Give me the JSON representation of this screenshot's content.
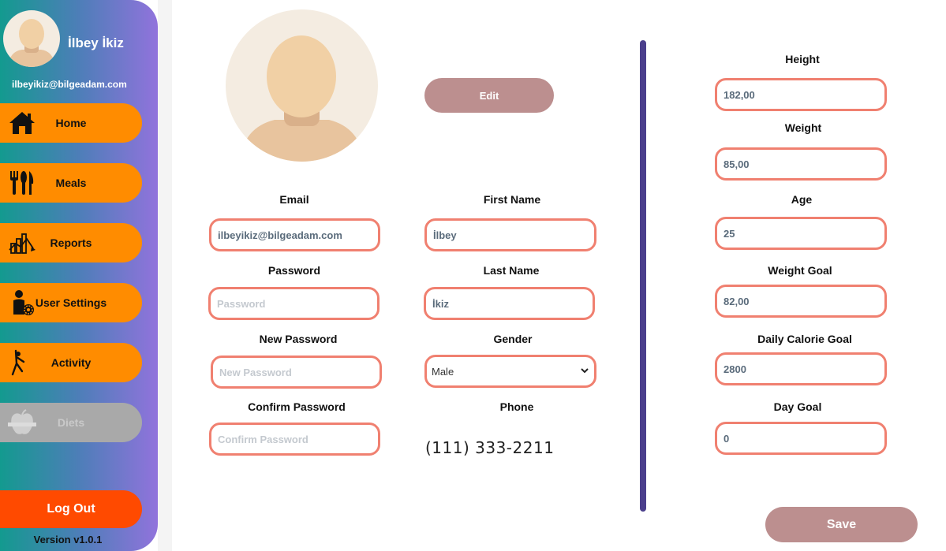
{
  "sidebar": {
    "user_name": "İlbey İkiz",
    "user_email": "ilbeyikiz@bilgeadam.com",
    "items": [
      {
        "label": "Home",
        "icon": "home-icon"
      },
      {
        "label": "Meals",
        "icon": "cutlery-icon"
      },
      {
        "label": "Reports",
        "icon": "reports-chart-icon"
      },
      {
        "label": "User Settings",
        "icon": "user-settings-icon"
      },
      {
        "label": "Activity",
        "icon": "running-person-icon"
      },
      {
        "label": "Diets",
        "icon": "apple-tape-icon",
        "disabled": true
      }
    ],
    "logout_label": "Log Out",
    "version": "Version v1.0.1",
    "accent_color": "#ff8c00",
    "logout_color": "#ff4a00"
  },
  "profile": {
    "edit_label": "Edit",
    "email": {
      "label": "Email",
      "value": "ilbeyikiz@bilgeadam.com"
    },
    "password": {
      "label": "Password",
      "placeholder": "Password"
    },
    "new_password": {
      "label": "New Password",
      "placeholder": "New Password"
    },
    "confirm_password": {
      "label": "Confirm Password",
      "placeholder": "Confirm Password"
    },
    "first_name": {
      "label": "First Name",
      "value": "İlbey"
    },
    "last_name": {
      "label": "Last Name",
      "value": "İkiz"
    },
    "gender": {
      "label": "Gender",
      "value": "Male"
    },
    "phone": {
      "label": "Phone",
      "value": "(111) 333-2211"
    }
  },
  "body_stats": {
    "height": {
      "label": "Height",
      "value": "182,00"
    },
    "weight": {
      "label": "Weight",
      "value": "85,00"
    },
    "age": {
      "label": "Age",
      "value": "25"
    },
    "weight_goal": {
      "label": "Weight Goal",
      "value": "82,00"
    },
    "daily_calorie_goal": {
      "label": "Daily Calorie Goal",
      "value": "2800"
    },
    "day_goal": {
      "label": "Day Goal",
      "value": "0"
    }
  },
  "save_label": "Save",
  "colors": {
    "field_border": "#f08070",
    "button": "#bc8f8f",
    "divider": "#4b3f8c"
  }
}
